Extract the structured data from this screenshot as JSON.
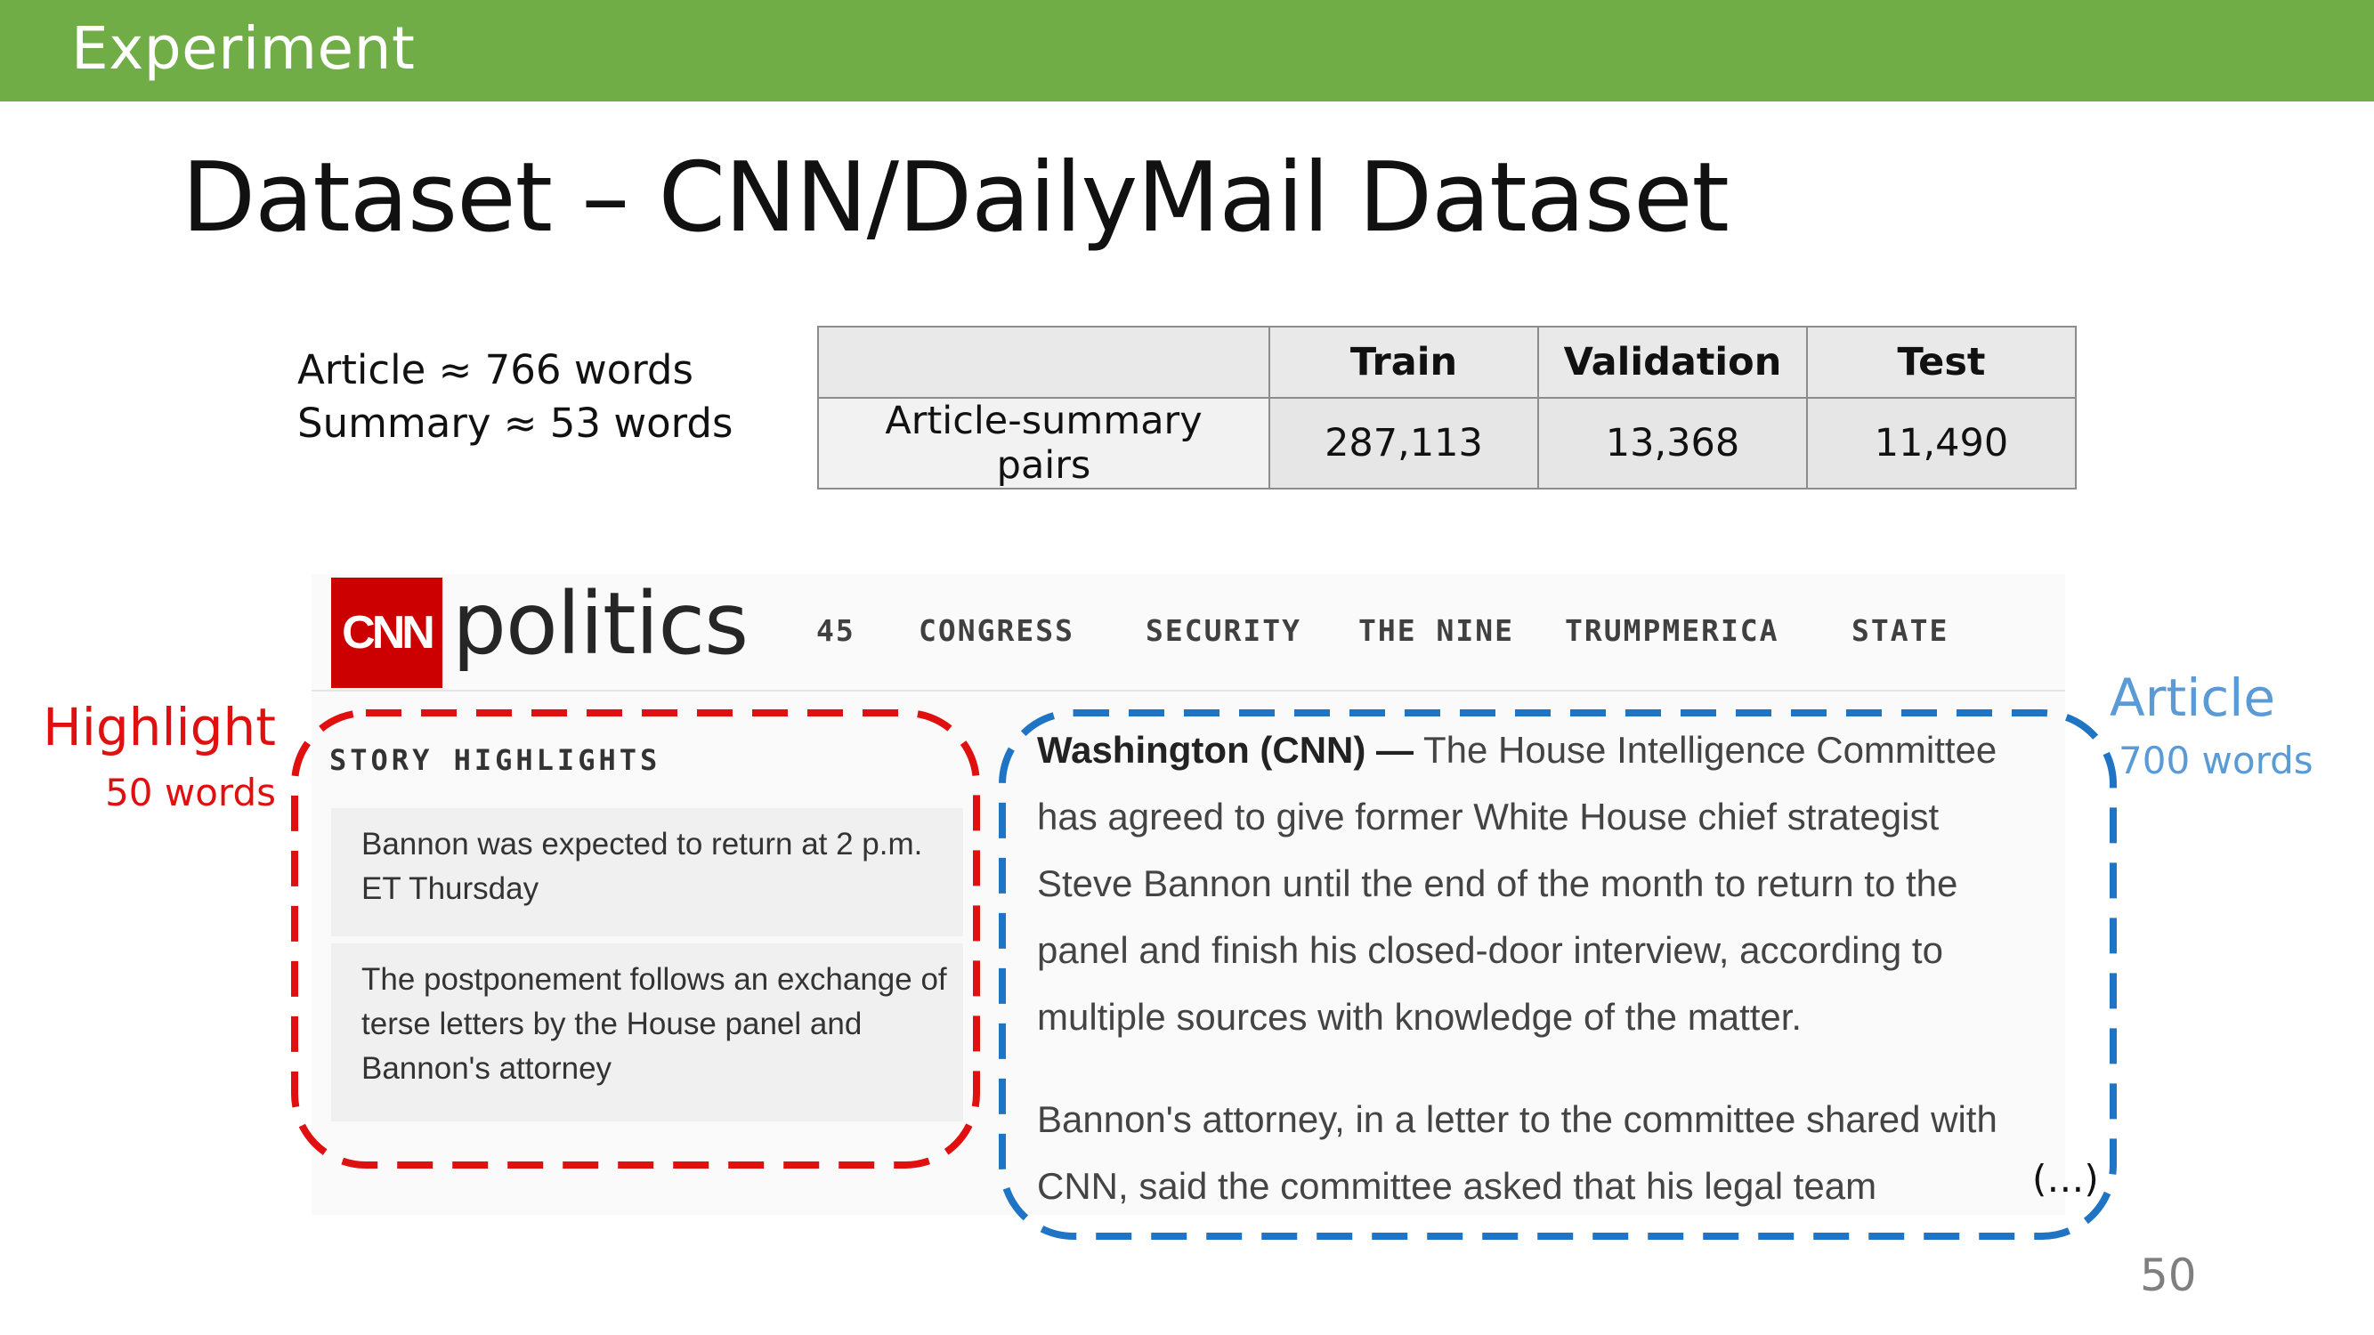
{
  "header": {
    "section": "Experiment"
  },
  "slide": {
    "title": "Dataset – CNN/DailyMail Dataset",
    "page_number": "50"
  },
  "stats": {
    "article_length": "Article ≈ 766 words",
    "summary_length": "Summary ≈ 53 words"
  },
  "table": {
    "columns": [
      "",
      "Train",
      "Validation",
      "Test"
    ],
    "rows": [
      {
        "label": "Article-summary pairs",
        "train": "287,113",
        "validation": "13,368",
        "test": "11,490"
      }
    ]
  },
  "cnn": {
    "logo_text": "CNN",
    "section": "politics",
    "nav": [
      "45",
      "CONGRESS",
      "SECURITY",
      "THE NINE",
      "TRUMPMERICA",
      "STATE"
    ],
    "story_heading": "STORY HIGHLIGHTS",
    "highlights": [
      "Bannon was expected to return at 2 p.m. ET Thursday",
      "The postponement follows an exchange of terse letters by the House panel and Bannon's attorney"
    ],
    "article_dateline": "Washington (CNN) —",
    "article_p1": "The House Intelligence Committee has agreed to give former White House chief strategist Steve Bannon until the end of the month to return to the panel and finish his closed-door interview, according to multiple sources with knowledge of the matter.",
    "article_p2": "Bannon's attorney, in a letter to the committee shared with CNN, said the committee asked that his legal team",
    "ellipsis": "(…)"
  },
  "annotations": {
    "highlight_label": "Highlight",
    "highlight_words": "50 words",
    "article_label": "Article",
    "article_words": "700 words",
    "highlight_color": "#E01010",
    "article_color": "#1F74C4"
  },
  "colors": {
    "header_bar": "#70AD47",
    "cnn_red": "#CC0000"
  }
}
